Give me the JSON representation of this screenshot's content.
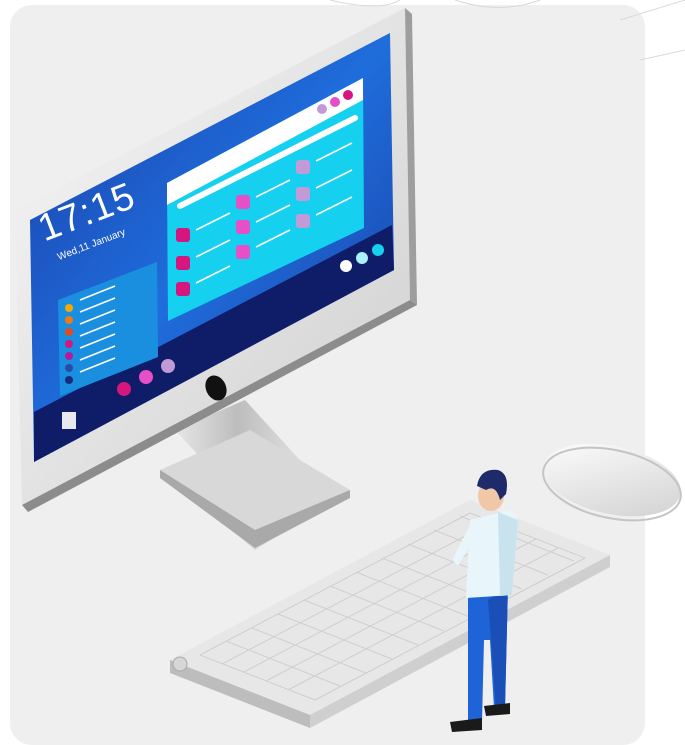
{
  "screen": {
    "time": "17:15",
    "date": "Wed,11 January"
  },
  "colors": {
    "background_card": "#efefef",
    "screen_dark": "#0f1c68",
    "screen_blue": "#1e63d6",
    "panel_cyan": "#16d0f0",
    "accent_magenta": "#d4167e",
    "accent_pink": "#e54fc8",
    "accent_lilac": "#c39ad8",
    "shirt": "#e8f6fb",
    "pants": "#1f63d8"
  },
  "icons": [
    "monitor-icon",
    "keyboard-icon",
    "mouse-icon",
    "person-icon"
  ]
}
